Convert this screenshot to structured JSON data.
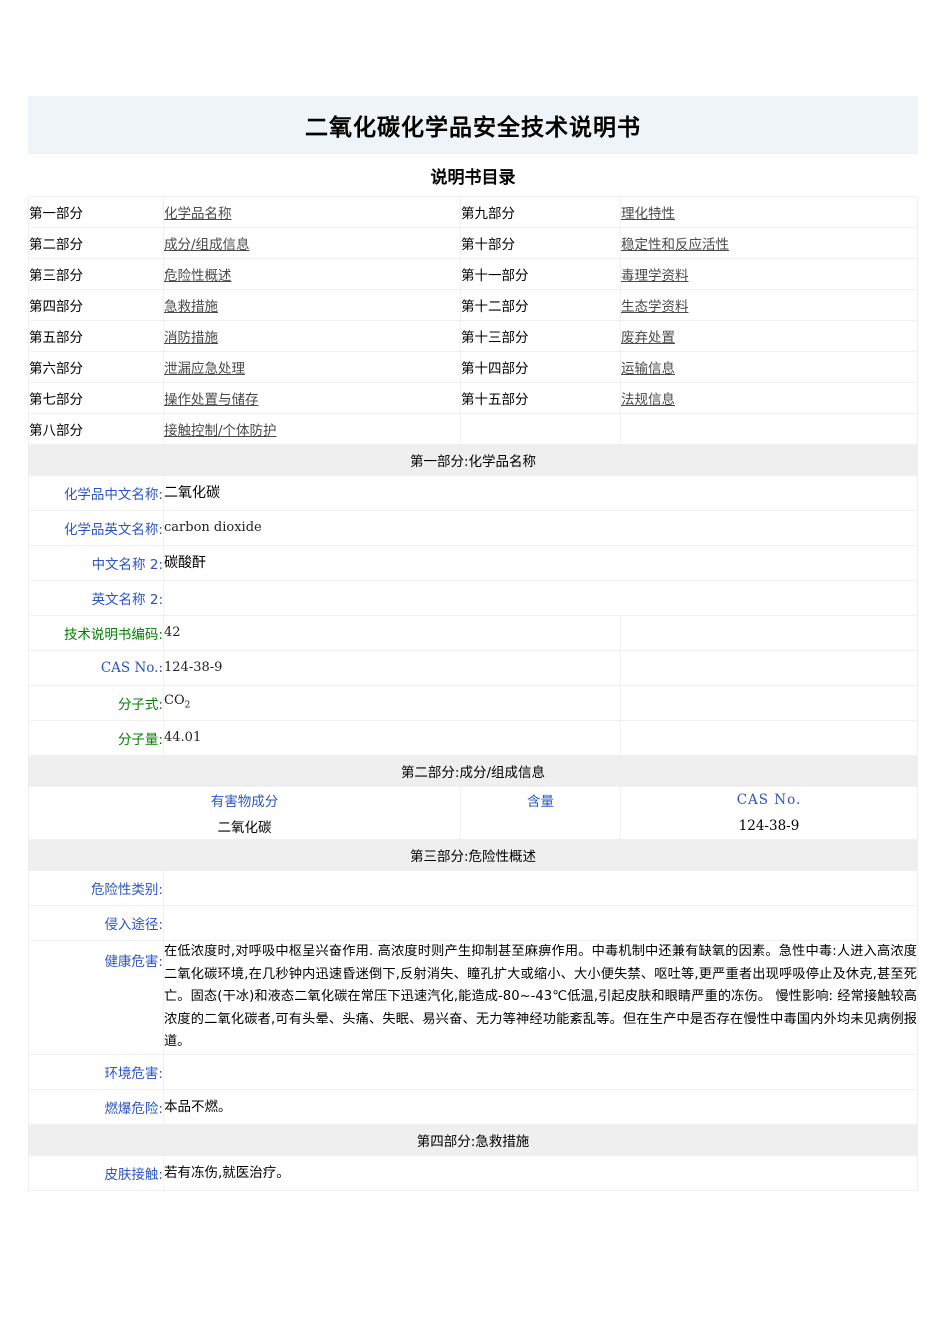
{
  "document": {
    "title": "二氧化碳化学品安全技术说明书",
    "toc_title": "说明书目录"
  },
  "toc": {
    "rows": [
      {
        "left_num": "第一部分",
        "left_link": "化学品名称",
        "right_num": "第九部分",
        "right_link": "理化特性"
      },
      {
        "left_num": "第二部分",
        "left_link": "成分/组成信息",
        "right_num": "第十部分",
        "right_link": "稳定性和反应活性"
      },
      {
        "left_num": "第三部分",
        "left_link": "危险性概述",
        "right_num": "第十一部分",
        "right_link": "毒理学资料"
      },
      {
        "left_num": "第四部分",
        "left_link": "急救措施",
        "right_num": "第十二部分",
        "right_link": "生态学资料"
      },
      {
        "left_num": "第五部分",
        "left_link": "消防措施",
        "right_num": "第十三部分",
        "right_link": "废弃处置"
      },
      {
        "left_num": "第六部分",
        "left_link": "泄漏应急处理",
        "right_num": "第十四部分",
        "right_link": "运输信息"
      },
      {
        "left_num": "第七部分",
        "left_link": "操作处置与储存",
        "right_num": "第十五部分",
        "right_link": "法规信息"
      },
      {
        "left_num": "第八部分",
        "left_link": "接触控制/个体防护",
        "right_num": "",
        "right_link": ""
      }
    ]
  },
  "section1": {
    "header": "第一部分:化学品名称",
    "rows": [
      {
        "label": "化学品中文名称:",
        "value": "二氧化碳"
      },
      {
        "label": "化学品英文名称:",
        "value": "carbon  dioxide"
      },
      {
        "label": "中文名称 2:",
        "value": "碳酸酐"
      },
      {
        "label": "英文名称 2:",
        "value": ""
      },
      {
        "label": "技术说明书编码:",
        "value": "42"
      },
      {
        "label": "CAS  No.:",
        "value": "124-38-9"
      },
      {
        "label": "分子式:",
        "value": "CO2"
      },
      {
        "label": "分子量:",
        "value": "44.01"
      }
    ]
  },
  "section2": {
    "header": "第二部分:成分/组成信息",
    "columns": [
      "有害物成分",
      "含量",
      "CAS No."
    ],
    "rows": [
      {
        "component": "二氧化碳",
        "content": "",
        "cas": "124-38-9"
      }
    ]
  },
  "section3": {
    "header": "第三部分:危险性概述",
    "rows": [
      {
        "label": "危险性类别:",
        "value": ""
      },
      {
        "label": "侵入途径:",
        "value": ""
      },
      {
        "label": "健康危害:",
        "value": "在低浓度时,对呼吸中枢呈兴奋作用. 高浓度时则产生抑制甚至麻痹作用。中毒机制中还兼有缺氧的因素。急性中毒:人进入高浓度二氧化碳环境,在几秒钟内迅速昏迷倒下,反射消失、瞳孔扩大或缩小、大小便失禁、呕吐等,更严重者出现呼吸停止及休克,甚至死亡。固态(干冰)和液态二氧化碳在常压下迅速汽化,能造成-80~-43℃低温,引起皮肤和眼睛严重的冻伤。 慢性影响: 经常接触较高浓度的二氧化碳者,可有头晕、头痛、失眠、易兴奋、无力等神经功能紊乱等。但在生产中是否存在慢性中毒国内外均未见病例报道。"
      },
      {
        "label": "环境危害:",
        "value": ""
      },
      {
        "label": "燃爆危险:",
        "value": "本品不燃。"
      }
    ]
  },
  "section4": {
    "header": "第四部分:急救措施",
    "rows": [
      {
        "label": "皮肤接触:",
        "value": "若有冻伤,就医治疗。"
      }
    ]
  },
  "colors": {
    "title_band": "#eff4f8",
    "section_header": "#efefef",
    "label_blue": "#2b55c4",
    "label_green": "#008000",
    "link": "#4a4a4a",
    "border": "#f0f0f0"
  }
}
